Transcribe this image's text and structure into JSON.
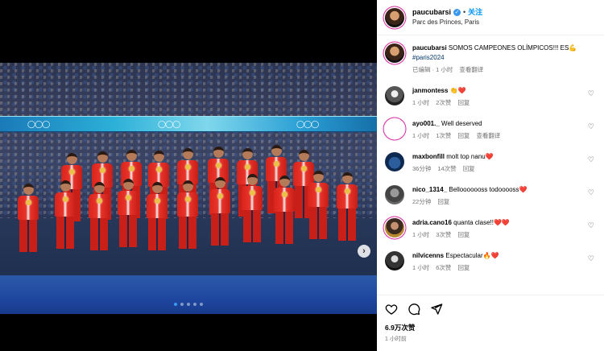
{
  "post": {
    "username": "paucubarsi",
    "follow_label": "关注",
    "location": "Parc des Princes, Paris"
  },
  "caption": {
    "username": "paucubarsi",
    "text": "SOMOS CAMPEONES OLÍMPICOS!!! ES",
    "emoji": "💪",
    "hashtag": "#paris2024",
    "meta_edited": "已编辑 · 1 小时",
    "meta_translate": "查看翻译"
  },
  "comments": [
    {
      "id": "jan",
      "username": "janmontess",
      "text": "👏❤️",
      "time": "1 小时",
      "likes": "2次赞",
      "reply": "回复",
      "translate": ""
    },
    {
      "id": "ayo",
      "username": "ayo001._",
      "text": "Well deserved",
      "time": "1 小时",
      "likes": "1次赞",
      "reply": "回复",
      "translate": "查看翻译"
    },
    {
      "id": "max",
      "username": "maxbonfill",
      "text": "molt top nanu❤️",
      "time": "36分钟",
      "likes": "14次赞",
      "reply": "回复",
      "translate": ""
    },
    {
      "id": "nico",
      "username": "nico_1314_",
      "text": "Bellooooooss todooooss❤️",
      "time": "22分钟",
      "likes": "",
      "reply": "回复",
      "translate": ""
    },
    {
      "id": "adria",
      "username": "adria.cano16",
      "text": "quanta clase!!❤️❤️",
      "time": "1 小时",
      "likes": "3次赞",
      "reply": "回复",
      "translate": ""
    },
    {
      "id": "nil",
      "username": "nilvicenns",
      "text": "Espectacular🔥❤️",
      "time": "1 小时",
      "likes": "6次赞",
      "reply": "回复",
      "translate": ""
    }
  ],
  "footer": {
    "likes": "6.9万次赞",
    "time": "1 小时前"
  },
  "icons": {
    "like": "heart-outline-icon",
    "comment": "comment-bubble-icon",
    "share": "paper-plane-icon",
    "verified": "verified-badge-icon",
    "next": "chevron-right-icon"
  },
  "carousel": {
    "total": 5,
    "active_index": 0
  }
}
